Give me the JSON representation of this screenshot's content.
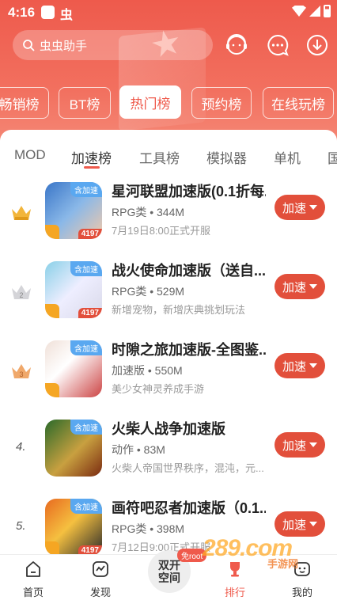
{
  "status_bar": {
    "time": "4:16",
    "app_glyph": "虫"
  },
  "search": {
    "placeholder": "虫虫助手"
  },
  "top_tabs": [
    {
      "label": "畅销榜",
      "active": false
    },
    {
      "label": "BT榜",
      "active": false
    },
    {
      "label": "热门榜",
      "active": true
    },
    {
      "label": "预约榜",
      "active": false
    },
    {
      "label": "在线玩榜",
      "active": false
    }
  ],
  "sub_tabs": [
    {
      "label": "MOD",
      "active": false
    },
    {
      "label": "加速榜",
      "active": true
    },
    {
      "label": "工具榜",
      "active": false
    },
    {
      "label": "模拟器",
      "active": false
    },
    {
      "label": "单机",
      "active": false
    },
    {
      "label": "国",
      "active": false
    }
  ],
  "list": [
    {
      "rank": "1",
      "title": "星河联盟加速版(0.1折每...",
      "meta": "RPG类 • 344M",
      "sub": "7月19日8:00正式开服",
      "badge": "含加速",
      "count": "4197",
      "button": "加速",
      "icon_colors": [
        "#3a76c8",
        "#f3c9a8"
      ]
    },
    {
      "rank": "2",
      "title": "战火使命加速版（送自...",
      "meta": "RPG类 • 529M",
      "sub": "新增宠物，新增庆典挑划玩法",
      "badge": "含加速",
      "count": "4197",
      "button": "加速",
      "icon_colors": [
        "#8ad0e8",
        "#d8d8e8"
      ]
    },
    {
      "rank": "3",
      "title": "时隙之旅加速版-全图鉴...",
      "meta": "加速版 • 550M",
      "sub": "美少女神灵养成手游",
      "badge": "含加速",
      "count": "",
      "button": "加速",
      "icon_colors": [
        "#f0e0d8",
        "#c44"
      ]
    },
    {
      "rank": "4",
      "title": "火柴人战争加速版",
      "meta": "动作 • 83M",
      "sub": "火柴人帝国世界秩序，混沌，元...",
      "badge": "含加速",
      "count": "",
      "button": "加速",
      "icon_colors": [
        "#2a6a2a",
        "#c8a040"
      ]
    },
    {
      "rank": "5",
      "title": "画符吧忍者加速版（0.1...",
      "meta": "RPG类 • 398M",
      "sub": "7月12日9:00正式开服",
      "badge": "含加速",
      "count": "4197",
      "button": "加速",
      "icon_colors": [
        "#e86a20",
        "#2a2a2a"
      ]
    }
  ],
  "rank_prefix_after_top3": ".",
  "bottom_nav": [
    {
      "label": "首页",
      "active": false
    },
    {
      "label": "发现",
      "active": false
    },
    {
      "label": "双开\n空间",
      "active": false
    },
    {
      "label": "排行",
      "active": true
    },
    {
      "label": "我的",
      "active": false
    }
  ],
  "center_badge": "免root",
  "watermark": {
    "logo": "289.com",
    "sub": "手游网"
  },
  "colors": {
    "accent": "#ef5a4c",
    "button": "#e24f3b",
    "header_top": "#ee5a4c"
  }
}
